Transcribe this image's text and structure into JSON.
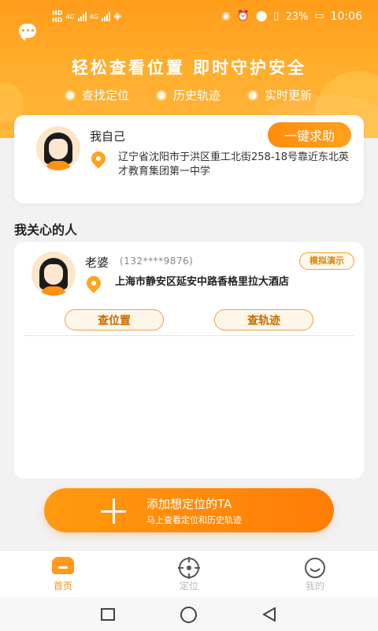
{
  "status_bar": {
    "network_left": "HD",
    "network_sig1": "4G",
    "network_sig2": "4G",
    "battery_pct": "23%",
    "time": "10:06"
  },
  "header": {
    "slogan": "轻松查看位置  即时守护安全",
    "features": [
      "查找定位",
      "历史轨迹",
      "实时更新"
    ]
  },
  "my_card": {
    "name": "我自己",
    "help_button": "一键求助",
    "address": "辽宁省沈阳市于洪区重工北街258-18号靠近东北英才教育集团第一中学"
  },
  "section_title": "我关心的人",
  "contacts": [
    {
      "name": "老婆",
      "phone": "(132****9876)",
      "badge": "模拟演示",
      "address": "上海市静安区延安中路香格里拉大酒店",
      "btn_locate": "查位置",
      "btn_track": "查轨迹"
    }
  ],
  "add_button": {
    "title": "添加想定位的TA",
    "subtitle": "马上查看定位和历史轨迹"
  },
  "tabbar": {
    "tabs": [
      {
        "label": "首页",
        "icon": "home-icon",
        "active": true
      },
      {
        "label": "定位",
        "icon": "target-icon",
        "active": false
      },
      {
        "label": "我的",
        "icon": "smile-icon",
        "active": false
      }
    ]
  },
  "colors": {
    "accent": "#ff9c1a",
    "accent_dark": "#ff7d06",
    "inactive": "#bbbbbb"
  }
}
